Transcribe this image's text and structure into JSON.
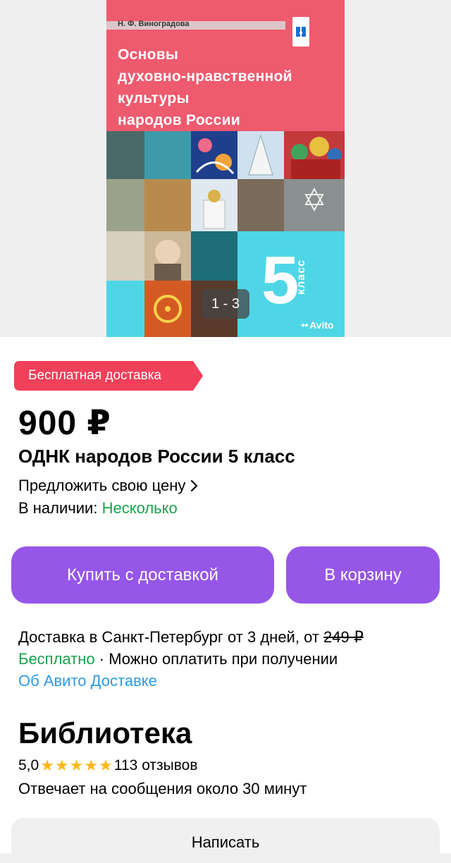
{
  "gallery": {
    "counter": "1 - 3",
    "watermark": "Avito",
    "cover": {
      "author": "Н. Ф. Виноградова",
      "title_lines": [
        "Основы",
        "духовно-нравственной",
        "культуры",
        "народов России"
      ],
      "grade": "5",
      "grade_word": "класс",
      "colors": {
        "top": "#ee5a6e",
        "bottom": "#4fd6e6"
      }
    }
  },
  "badge": {
    "label": "Бесплатная доставка",
    "color": "#f0405a"
  },
  "listing": {
    "price": "900 ₽",
    "title": "ОДНК народов России 5 класс",
    "offer_price": "Предложить свою цену",
    "stock_label": "В наличии:",
    "stock_value": "Несколько"
  },
  "actions": {
    "buy_label": "Купить с доставкой",
    "cart_label": "В корзину",
    "accent": "#9656e8"
  },
  "delivery": {
    "line1": "Доставка в Санкт-Петербург от 3 дней, от ",
    "old_price": "249 ₽",
    "free": "Бесплатно",
    "separator": " · ",
    "payment": "Можно оплатить при получении",
    "about_link": "Об Авито Доставке"
  },
  "seller": {
    "name": "Библиотека",
    "rating": "5,0",
    "stars": 5,
    "reviews": "113 отзывов",
    "response": "Отвечает на сообщения около 30 минут",
    "write_label": "Написать"
  }
}
